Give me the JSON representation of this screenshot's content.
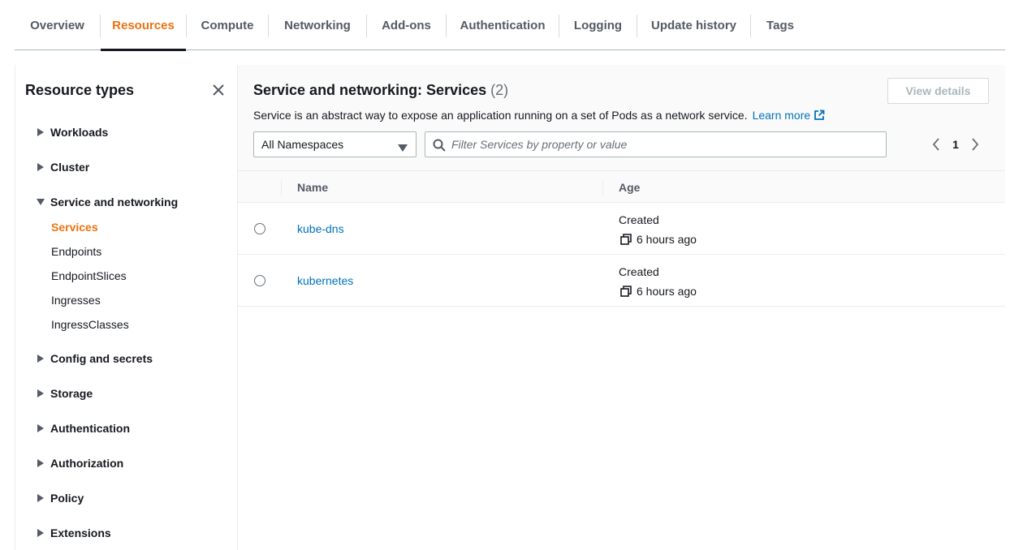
{
  "tabs": [
    {
      "label": "Overview"
    },
    {
      "label": "Resources",
      "active": true
    },
    {
      "label": "Compute"
    },
    {
      "label": "Networking"
    },
    {
      "label": "Add-ons"
    },
    {
      "label": "Authentication"
    },
    {
      "label": "Logging"
    },
    {
      "label": "Update history"
    },
    {
      "label": "Tags"
    }
  ],
  "sidebar": {
    "title": "Resource types",
    "groups": [
      {
        "label": "Workloads",
        "expanded": false
      },
      {
        "label": "Cluster",
        "expanded": false
      },
      {
        "label": "Service and networking",
        "expanded": true,
        "items": [
          {
            "label": "Services",
            "active": true
          },
          {
            "label": "Endpoints"
          },
          {
            "label": "EndpointSlices"
          },
          {
            "label": "Ingresses"
          },
          {
            "label": "IngressClasses"
          }
        ]
      },
      {
        "label": "Config and secrets",
        "expanded": false
      },
      {
        "label": "Storage",
        "expanded": false
      },
      {
        "label": "Authentication",
        "expanded": false
      },
      {
        "label": "Authorization",
        "expanded": false
      },
      {
        "label": "Policy",
        "expanded": false
      },
      {
        "label": "Extensions",
        "expanded": false
      }
    ]
  },
  "main": {
    "title": "Service and networking: Services",
    "count": "(2)",
    "view_details_label": "View details",
    "description": "Service is an abstract way to expose an application running on a set of Pods as a network service.",
    "learn_more": "Learn more",
    "namespace_select": "All Namespaces",
    "search_placeholder": "Filter Services by property or value",
    "page_number": "1",
    "columns": {
      "name": "Name",
      "age": "Age"
    },
    "rows": [
      {
        "name": "kube-dns",
        "age_label": "Created",
        "age": "6 hours ago"
      },
      {
        "name": "kubernetes",
        "age_label": "Created",
        "age": "6 hours ago"
      }
    ]
  },
  "colors": {
    "accent": "#ec7211",
    "link": "#0073bb",
    "text": "#16191f",
    "muted": "#545b64"
  }
}
